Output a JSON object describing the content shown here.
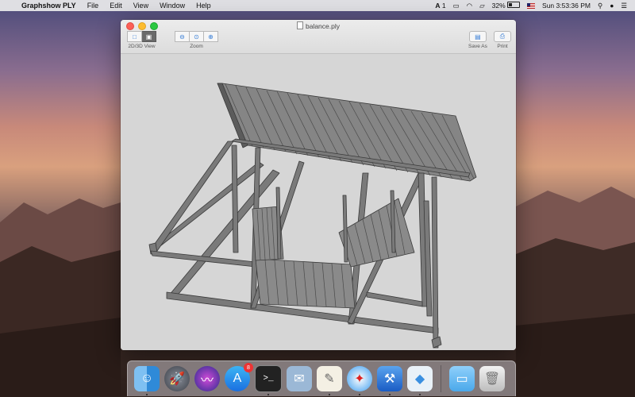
{
  "menubar": {
    "apple": "",
    "app_name": "Graphshow PLY",
    "menus": [
      "File",
      "Edit",
      "View",
      "Window",
      "Help"
    ],
    "status": {
      "adobe": "1",
      "battery": "32%",
      "clock": "Sun 3:53:36 PM"
    }
  },
  "window": {
    "title": "balance.ply",
    "toolbar": {
      "view_label": "2D/3D View",
      "zoom_label": "Zoom",
      "save_label": "Save As",
      "print_label": "Print"
    }
  },
  "dock": {
    "icons": [
      "finder-icon",
      "launchpad-icon",
      "siri-icon",
      "app-store-icon",
      "terminal-icon",
      "mail-icon",
      "textedit-icon",
      "safari-icon",
      "xcode-icon",
      "graphshow-ply-icon",
      "folder-icon",
      "trash-icon"
    ],
    "app_store_badge": "8"
  },
  "colors": {
    "structure": "#6e6e6e",
    "canvas": "#d6d6d6"
  }
}
